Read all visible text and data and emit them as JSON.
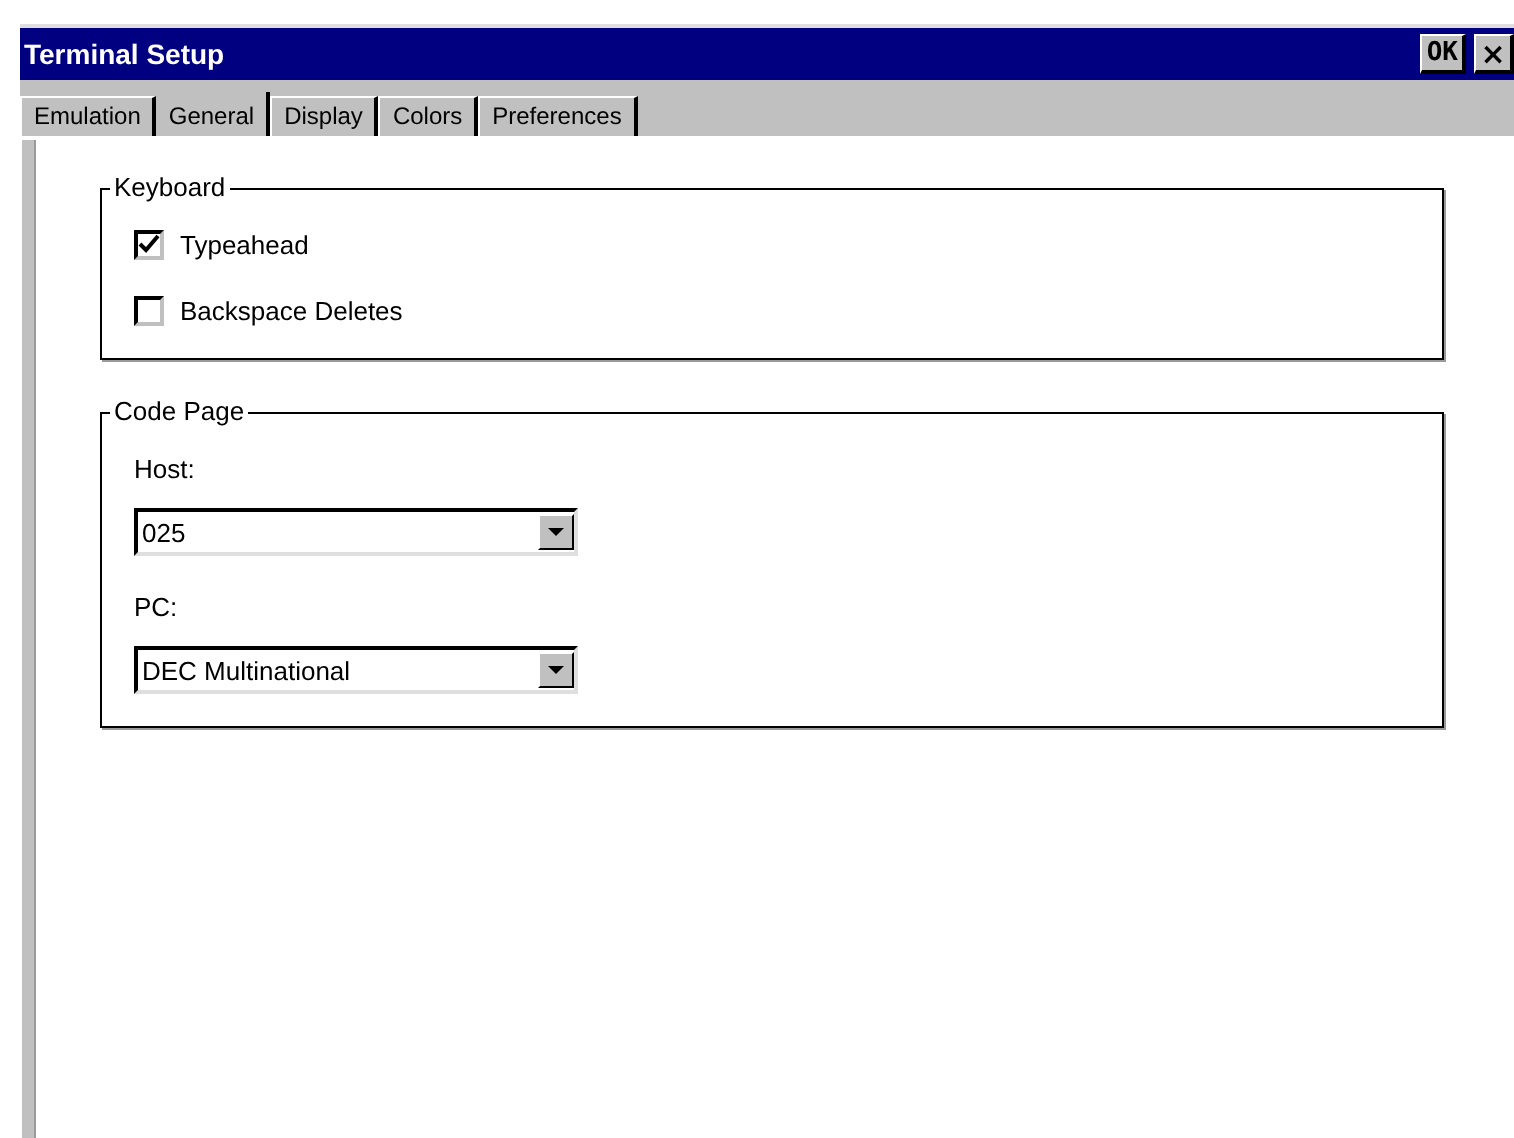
{
  "window": {
    "title": "Terminal Setup",
    "buttons": [
      {
        "kind": "ok",
        "label": "OK"
      },
      {
        "kind": "close",
        "label": "×"
      }
    ]
  },
  "tabs": [
    {
      "label": "Emulation",
      "selected": false
    },
    {
      "label": "General",
      "selected": true
    },
    {
      "label": "Display",
      "selected": false
    },
    {
      "label": "Colors",
      "selected": false
    },
    {
      "label": "Preferences",
      "selected": false
    }
  ],
  "groups": [
    {
      "title": "Keyboard",
      "items": [
        {
          "kind": "checkbox",
          "label": "Typeahead",
          "checked": true
        },
        {
          "kind": "checkbox",
          "label": "Backspace Deletes",
          "checked": false
        }
      ]
    },
    {
      "title": "Code Page",
      "items": [
        {
          "kind": "dropdown",
          "label": "Host:",
          "value": "025"
        },
        {
          "kind": "dropdown",
          "label": "PC:",
          "value": "DEC Multinational"
        }
      ]
    }
  ]
}
